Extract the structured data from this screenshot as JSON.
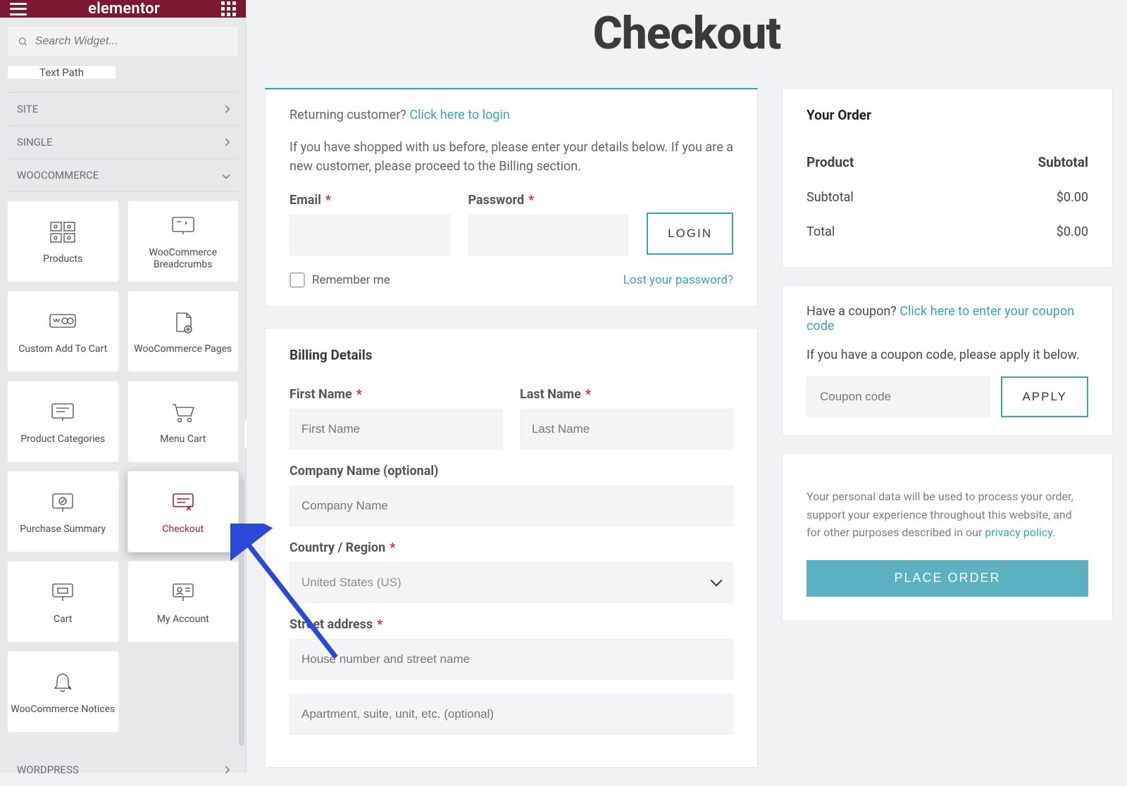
{
  "sidebar": {
    "brand": "elementor",
    "search_placeholder": "Search Widget...",
    "text_path_label": "Text Path",
    "sections": {
      "site": "SITE",
      "single": "SINGLE",
      "woocommerce": "WOOCOMMERCE",
      "wordpress": "WORDPRESS"
    },
    "widgets": [
      {
        "label": "Products"
      },
      {
        "label": "WooCommerce Breadcrumbs"
      },
      {
        "label": "Custom Add To Cart"
      },
      {
        "label": "WooCommerce Pages"
      },
      {
        "label": "Product Categories"
      },
      {
        "label": "Menu Cart"
      },
      {
        "label": "Purchase Summary"
      },
      {
        "label": "Checkout"
      },
      {
        "label": "Cart"
      },
      {
        "label": "My Account"
      },
      {
        "label": "WooCommerce Notices"
      }
    ]
  },
  "page": {
    "title": "Checkout",
    "returning": {
      "prompt": "Returning customer? ",
      "link": "Click here to login",
      "desc": "If you have shopped with us before, please enter your details below. If you are a new customer, please proceed to the Billing section.",
      "email_label": "Email",
      "password_label": "Password",
      "login_btn": "LOGIN",
      "remember": "Remember me",
      "lost": "Lost your password?"
    },
    "billing": {
      "title": "Billing Details",
      "first_name_label": "First Name",
      "first_name_ph": "First Name",
      "last_name_label": "Last Name",
      "last_name_ph": "Last Name",
      "company_label": "Company Name (optional)",
      "company_ph": "Company Name",
      "country_label": "Country / Region",
      "country_value": "United States (US)",
      "street_label": "Street address",
      "street_ph1": "House number and street name",
      "street_ph2": "Apartment, suite, unit, etc. (optional)"
    },
    "order": {
      "title": "Your Order",
      "product_h": "Product",
      "subtotal_h": "Subtotal",
      "subtotal_label": "Subtotal",
      "subtotal_value": "$0.00",
      "total_label": "Total",
      "total_value": "$0.00"
    },
    "coupon": {
      "prompt": "Have a coupon? ",
      "link": "Click here to enter your coupon code",
      "desc": "If you have a coupon code, please apply it below.",
      "placeholder": "Coupon code",
      "apply": "APPLY"
    },
    "place": {
      "privacy_pre": "Your personal data will be used to process your order, support your experience throughout this website, and for other purposes described in our ",
      "privacy_link": "privacy policy",
      "privacy_post": ".",
      "button": "PLACE ORDER"
    }
  }
}
